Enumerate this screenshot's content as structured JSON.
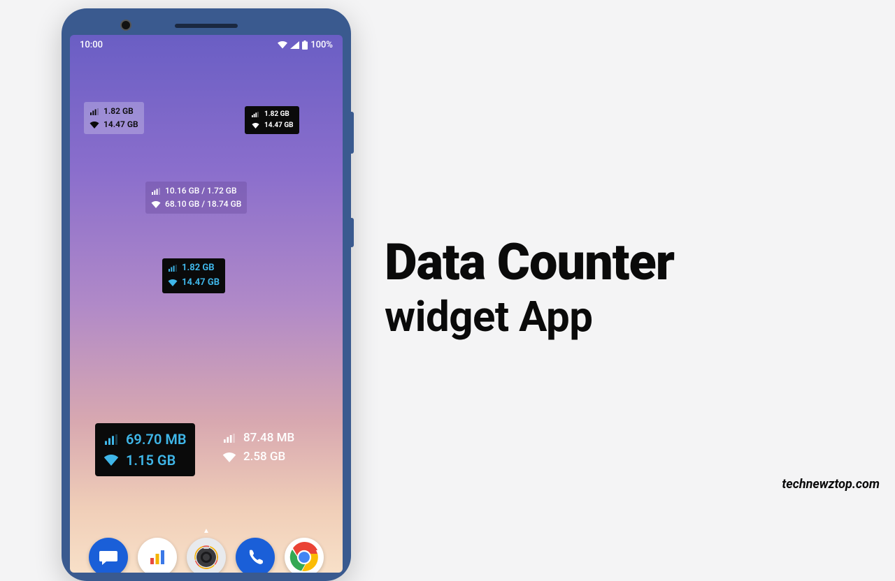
{
  "status_bar": {
    "time": "10:00",
    "battery": "100%"
  },
  "widgets": {
    "light_trans": {
      "mobile": "1.82 GB",
      "wifi": "14.47 GB"
    },
    "dark_small": {
      "mobile": "1.82 GB",
      "wifi": "14.47 GB"
    },
    "purple": {
      "mobile": "10.16 GB / 1.72 GB",
      "wifi": "68.10 GB / 18.74 GB"
    },
    "cyan_small": {
      "mobile": "1.82 GB",
      "wifi": "14.47 GB"
    },
    "large_cyan": {
      "mobile": "69.70 MB",
      "wifi": "1.15 GB"
    },
    "plain_white": {
      "mobile": "87.48 MB",
      "wifi": "2.58 GB"
    }
  },
  "title": {
    "line1": "Data Counter",
    "line2": "widget App"
  },
  "watermark": "technewztop.com"
}
